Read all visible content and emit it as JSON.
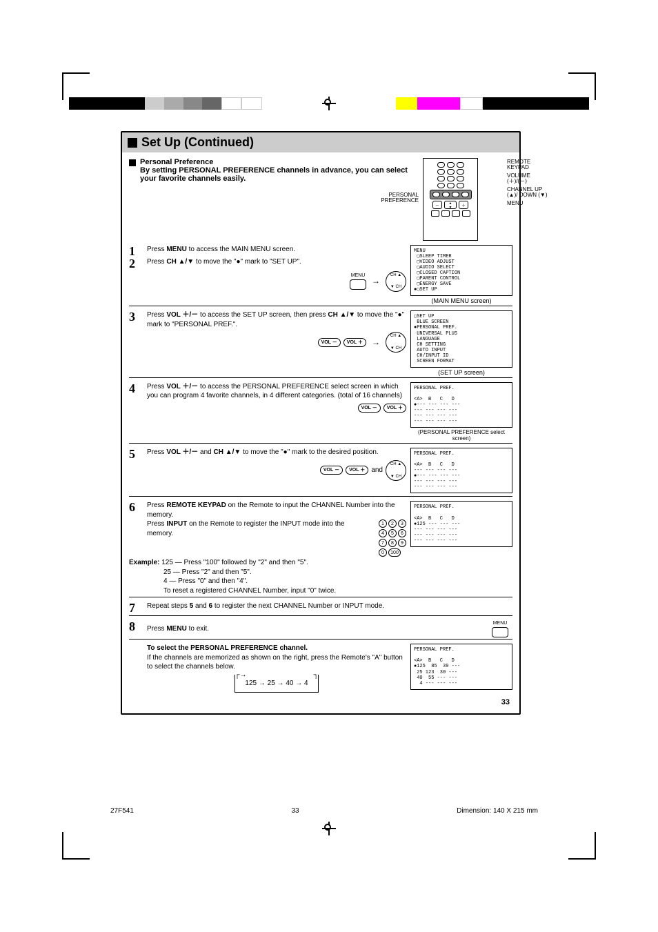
{
  "page_title": "Set Up (Continued)",
  "intro": {
    "heading": "Personal Preference",
    "body": "By setting PERSONAL PREFERENCE channels in advance, you can select your favorite channels easily.",
    "pp_label_1": "PERSONAL",
    "pp_label_2": "PREFERENCE"
  },
  "remote_callouts": {
    "keypad": "REMOTE KEYPAD",
    "volume": "VOLUME (＋)/(－)",
    "channel": "CHANNEL UP (▲)/ DOWN (▼)",
    "menu": "MENU"
  },
  "steps": {
    "s1": {
      "num": "1",
      "body_a": "Press ",
      "bold_a": "MENU",
      "body_b": " to access the MAIN MENU screen."
    },
    "s2": {
      "num": "2",
      "body_a": "Press ",
      "bold_a": "CH ▲/▼",
      "body_b": " to move the \"●\" mark to \"SET UP\"."
    },
    "s3": {
      "num": "3",
      "body_a": "Press ",
      "bold_a": "VOL ＋/－",
      "body_b": " to access the SET UP screen, then press ",
      "bold_b": "CH ▲/▼",
      "body_c": " to move the \"●\" mark to \"PERSONAL PREF.\"."
    },
    "s4": {
      "num": "4",
      "body_a": "Press ",
      "bold_a": "VOL ＋/－",
      "body_b": " to access the PERSONAL PREFERENCE select screen in which you can program 4 favorite channels, in 4 different categories. (total of 16 channels)"
    },
    "s5": {
      "num": "5",
      "body_a": "Press ",
      "bold_a": "VOL ＋/－",
      "body_b": " and ",
      "bold_b": "CH ▲/▼",
      "body_c": " to move the \"●\" mark to the desired position."
    },
    "s6": {
      "num": "6",
      "body_a": "Press ",
      "bold_a": "REMOTE KEYPAD",
      "body_b": " on the Remote to input the CHANNEL Number into the memory.",
      "body_c": "Press ",
      "bold_c": "INPUT",
      "body_d": " on the Remote to register the INPUT mode into the memory.",
      "example_label": "Example:",
      "ex1": "125 — Press \"100\" followed by \"2\" and then \"5\".",
      "ex2": "25 — Press \"2\" and then \"5\".",
      "ex3": "4 — Press \"0\" and then \"4\".",
      "reset": "To reset a registered CHANNEL Number, input \"0\" twice."
    },
    "s7": {
      "num": "7",
      "body_a": "Repeat steps ",
      "bold_a": "5",
      "body_b": " and ",
      "bold_b": "6",
      "body_c": " to register the next CHANNEL Number or INPUT mode."
    },
    "s8": {
      "num": "8",
      "body_a": "Press ",
      "bold_a": "MENU",
      "body_b": " to exit."
    }
  },
  "final": {
    "heading": "To select the PERSONAL PREFERENCE channel.",
    "body": "If the channels are memorized as shown on the right, press the Remote's \"A\" button to select the channels below.",
    "flow": "125 → 25 → 40 → 4"
  },
  "screens": {
    "main_menu": {
      "title": "MENU",
      "items": [
        "SLEEP TIMER",
        "VIDEO ADJUST",
        "AUDIO SELECT",
        "CLOSED CAPTION",
        "PARENT CONTROL",
        "ENERGY SAVE",
        "SET UP"
      ],
      "caption": "(MAIN MENU screen)"
    },
    "setup": {
      "title": "SET UP",
      "items": [
        "BLUE SCREEN",
        "PERSONAL PREF.",
        "UNIVERSAL PLUS",
        "LANGUAGE",
        "CH SETTING",
        "AUTO INPUT",
        "CH/INPUT ID",
        "SCREEN FORMAT"
      ],
      "caption": "(SET UP screen)"
    },
    "pp_select": {
      "title": "PERSONAL PREF.",
      "header": "<A>  B   C   D",
      "row1": "●--- --- --- ---",
      "rows": [
        "--- --- --- ---",
        "--- --- --- ---",
        "--- --- --- ---"
      ],
      "caption": "(PERSONAL PREFERENCE select screen)"
    },
    "pp_cursor": {
      "title": "PERSONAL PREF.",
      "header": "<A>  B   C   D",
      "rows": [
        "--- --- --- ---",
        "●--- --- --- ---",
        "--- --- --- ---",
        "--- --- --- ---"
      ]
    },
    "pp_entered": {
      "title": "PERSONAL PREF.",
      "header": "<A>  B   C   D",
      "row1": "●125 --- --- ---",
      "rows": [
        "--- --- --- ---",
        "--- --- --- ---",
        "--- --- --- ---"
      ]
    },
    "pp_filled": {
      "title": "PERSONAL PREF.",
      "header": "<A>  B   C   D",
      "rows": [
        "●125  85  39 ---",
        " 25 123  30 ---",
        " 40  55 --- ---",
        "  4 --- --- ---"
      ]
    }
  },
  "buttons": {
    "menu_small": "MENU",
    "vol_minus": "VOL －",
    "vol_plus": "VOL ＋",
    "ch_up": "CH ▲",
    "ch_down": "▼ CH",
    "and": "and"
  },
  "keypad": [
    "1",
    "2",
    "3",
    "4",
    "5",
    "6",
    "7",
    "8",
    "9",
    "0",
    "100"
  ],
  "page_number": "33",
  "footer": {
    "model": "27F541",
    "folio": "33",
    "dimension": "Dimension: 140  X  215 mm"
  }
}
